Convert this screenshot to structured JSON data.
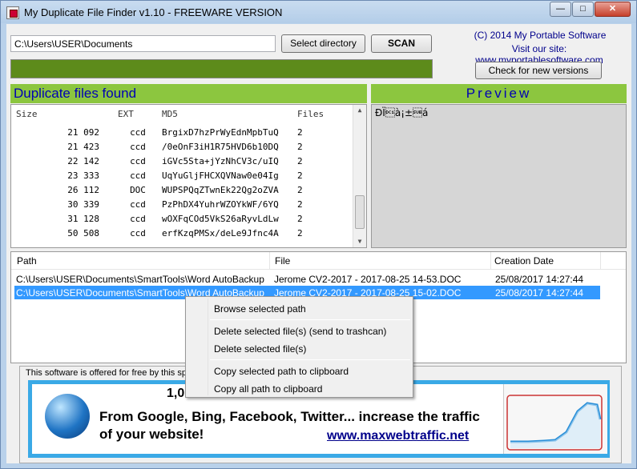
{
  "window": {
    "title": "My Duplicate File Finder v1.10 - FREEWARE VERSION",
    "controls": {
      "minimize": "—",
      "maximize": "□",
      "close": "✕"
    }
  },
  "toolbar": {
    "path_value": "C:\\Users\\USER\\Documents",
    "select_label": "Select directory",
    "scan_label": "SCAN",
    "copyright": "(C) 2014 My Portable Software",
    "site": "Visit our site: www.myportablesoftware.com",
    "check_label": "Check for new versions"
  },
  "duplicates": {
    "title": "Duplicate files found",
    "columns": {
      "size": "Size",
      "ext": "EXT",
      "md5": "MD5",
      "files": "Files"
    },
    "rows": [
      {
        "size": "21 092",
        "ext": "ccd",
        "md5": "BrgixD7hzPrWyEdnMpbTuQ",
        "files": "2"
      },
      {
        "size": "21 423",
        "ext": "ccd",
        "md5": "/0eOnF3iH1R75HVD6b10DQ",
        "files": "2"
      },
      {
        "size": "22 142",
        "ext": "ccd",
        "md5": "iGVc5Sta+jYzNhCV3c/uIQ",
        "files": "2"
      },
      {
        "size": "23 333",
        "ext": "ccd",
        "md5": "UqYuGljFHCXQVNaw0e04Ig",
        "files": "2"
      },
      {
        "size": "26 112",
        "ext": "DOC",
        "md5": "WUPSPQqZTwnEk22Qg2oZVA",
        "files": "2"
      },
      {
        "size": "30 339",
        "ext": "ccd",
        "md5": "PzPhDX4YuhrWZOYkWF/6YQ",
        "files": "2"
      },
      {
        "size": "31 128",
        "ext": "ccd",
        "md5": "wOXFqCOd5VkS26aRyvLdLw",
        "files": "2"
      },
      {
        "size": "50 508",
        "ext": "ccd",
        "md5": "erfKzqPMSx/deLe9Jfnc4A",
        "files": "2"
      }
    ]
  },
  "preview": {
    "title": "Preview",
    "content": "ÐÏ\u0011à¡±\u001aá"
  },
  "files": {
    "columns": {
      "path": "Path",
      "file": "File",
      "date": "Creation Date"
    },
    "rows": [
      {
        "path": "C:\\Users\\USER\\Documents\\SmartTools\\Word AutoBackup",
        "file": "Jerome CV2-2017 - 2017-08-25  14-53.DOC",
        "date": "25/08/2017 14:27:44"
      },
      {
        "path": "C:\\Users\\USER\\Documents\\SmartTools\\Word AutoBackup",
        "file": "Jerome CV2-2017 - 2017-08-25  15-02.DOC",
        "date": "25/08/2017 14:27:44"
      }
    ]
  },
  "context_menu": {
    "items": [
      "Browse selected path",
      "Delete selected file(s) (send to trashcan)",
      "Delete selected file(s)",
      "Copy selected path to clipboard",
      "Copy all path to clipboard"
    ]
  },
  "ad": {
    "caption": "This software is offered for free by this spo",
    "count": "1,0",
    "headline": "From Google, Bing, Facebook, Twitter... increase the traffic of your website!",
    "link": "www.maxwebtraffic.net"
  },
  "colors": {
    "accent_green": "#8cc63f",
    "progress_green": "#5d8b1b",
    "title_blue": "#0000b4",
    "selection": "#3399ff"
  }
}
